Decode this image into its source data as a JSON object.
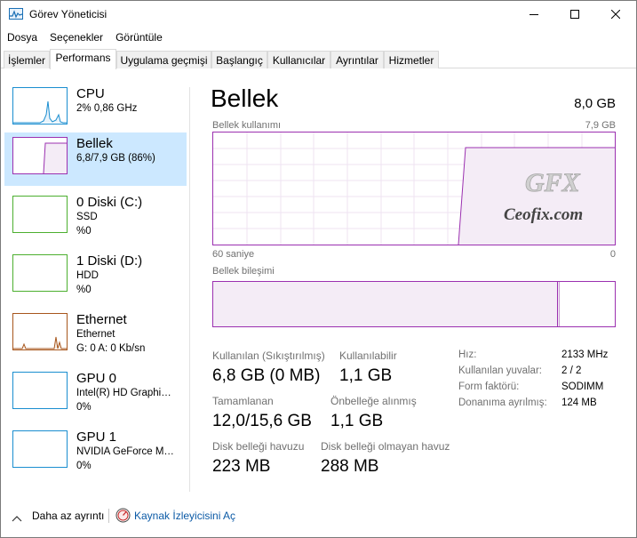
{
  "window": {
    "title": "Görev Yöneticisi",
    "controls": {
      "minimize": "minimize-icon",
      "maximize": "maximize-icon",
      "close": "close-icon"
    }
  },
  "menu": [
    "Dosya",
    "Seçenekler",
    "Görüntüle"
  ],
  "tabs": [
    {
      "label": "İşlemler",
      "active": false
    },
    {
      "label": "Performans",
      "active": true
    },
    {
      "label": "Uygulama geçmişi",
      "active": false
    },
    {
      "label": "Başlangıç",
      "active": false
    },
    {
      "label": "Kullanıcılar",
      "active": false
    },
    {
      "label": "Ayrıntılar",
      "active": false
    },
    {
      "label": "Hizmetler",
      "active": false
    }
  ],
  "sidebar": {
    "items": [
      {
        "title": "CPU",
        "line1": "2%  0,86 GHz",
        "line2": "",
        "color": "#1a8ed0",
        "selected": false
      },
      {
        "title": "Bellek",
        "line1": "6,8/7,9 GB (86%)",
        "line2": "",
        "color": "#9b30b0",
        "selected": true
      },
      {
        "title": "0 Diski (C:)",
        "line1": "SSD",
        "line2": "%0",
        "color": "#4caf2f",
        "selected": false
      },
      {
        "title": "1 Diski (D:)",
        "line1": "HDD",
        "line2": "%0",
        "color": "#4caf2f",
        "selected": false
      },
      {
        "title": "Ethernet",
        "line1": "Ethernet",
        "line2": "G: 0  A: 0 Kb/sn",
        "color": "#a7561c",
        "selected": false
      },
      {
        "title": "GPU 0",
        "line1": "Intel(R) HD Graphi…",
        "line2": "0%",
        "color": "#1a8ed0",
        "selected": false
      },
      {
        "title": "GPU 1",
        "line1": "NVIDIA GeForce M…",
        "line2": "0%",
        "color": "#1a8ed0",
        "selected": false
      }
    ]
  },
  "main": {
    "title": "Bellek",
    "total": "8,0 GB",
    "usage_label": "Bellek kullanımı",
    "usage_max": "7,9 GB",
    "axis_left": "60 saniye",
    "axis_right": "0",
    "composition_label": "Bellek bileşimi",
    "composition_in_use_fraction": 0.86,
    "composition_standby_fraction": 0.14,
    "stats": {
      "in_use_label": "Kullanılan (Sıkıştırılmış)",
      "in_use_value": "6,8 GB (0 MB)",
      "available_label": "Kullanılabilir",
      "available_value": "1,1 GB",
      "committed_label": "Tamamlanan",
      "committed_value": "12,0/15,6 GB",
      "cached_label": "Önbelleğe alınmış",
      "cached_value": "1,1 GB",
      "paged_label": "Disk belleği havuzu",
      "paged_value": "223 MB",
      "nonpaged_label": "Disk belleği olmayan havuz",
      "nonpaged_value": "288 MB"
    },
    "specs": [
      {
        "label": "Hız:",
        "value": "2133 MHz"
      },
      {
        "label": "Kullanılan yuvalar:",
        "value": "2 / 2"
      },
      {
        "label": "Form faktörü:",
        "value": "SODIMM"
      },
      {
        "label": "Donanıma ayrılmış:",
        "value": "124 MB"
      }
    ],
    "watermark": "Ceofix.com"
  },
  "footer": {
    "fewer_details": "Daha az ayrıntı",
    "resource_monitor": "Kaynak İzleyicisini Aç"
  }
}
